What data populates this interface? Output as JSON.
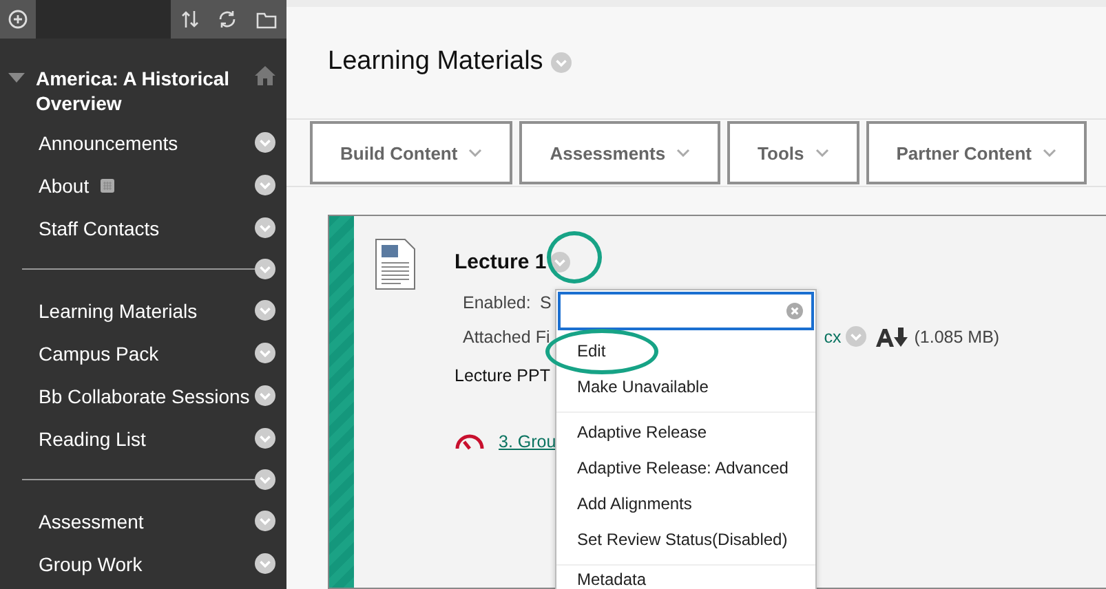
{
  "course": {
    "title": "America: A Historical Overview",
    "expanded": true
  },
  "menu": [
    {
      "kind": "link",
      "label": "Announcements",
      "flagged": false
    },
    {
      "kind": "link",
      "label": "About",
      "flagged": true
    },
    {
      "kind": "link",
      "label": "Staff Contacts",
      "flagged": false
    },
    {
      "kind": "divider"
    },
    {
      "kind": "link",
      "label": "Learning Materials",
      "flagged": false
    },
    {
      "kind": "link",
      "label": "Campus Pack",
      "flagged": false
    },
    {
      "kind": "link",
      "label": "Bb Collaborate Sessions",
      "flagged": false
    },
    {
      "kind": "link",
      "label": "Reading List",
      "flagged": false
    },
    {
      "kind": "divider"
    },
    {
      "kind": "link",
      "label": "Assessment",
      "flagged": false
    },
    {
      "kind": "link",
      "label": "Group Work",
      "flagged": false
    }
  ],
  "page": {
    "title": "Learning Materials"
  },
  "toolbar": [
    "Build Content",
    "Assessments",
    "Tools",
    "Partner Content"
  ],
  "item": {
    "title": "Lecture 1",
    "menu_circled": true,
    "enabled_label": "Enabled:",
    "enabled_value": "S",
    "attached_label": "Attached Fi",
    "attached_file": "cx",
    "file_size": "(1.085 MB)",
    "description": "Lecture PPT",
    "link": "3. Grou"
  },
  "context_menu": {
    "sections": [
      {
        "items": [
          {
            "label": "Edit",
            "circled": true
          },
          {
            "label": "Make Unavailable",
            "circled": false
          }
        ]
      },
      {
        "items": [
          {
            "label": "Adaptive Release",
            "circled": false
          },
          {
            "label": "Adaptive Release: Advanced",
            "circled": false
          },
          {
            "label": "Add Alignments",
            "circled": false
          },
          {
            "label": "Set Review Status(Disabled)",
            "circled": false
          }
        ]
      },
      {
        "items": [
          {
            "label": "Metadata",
            "circled": false
          }
        ]
      }
    ]
  }
}
